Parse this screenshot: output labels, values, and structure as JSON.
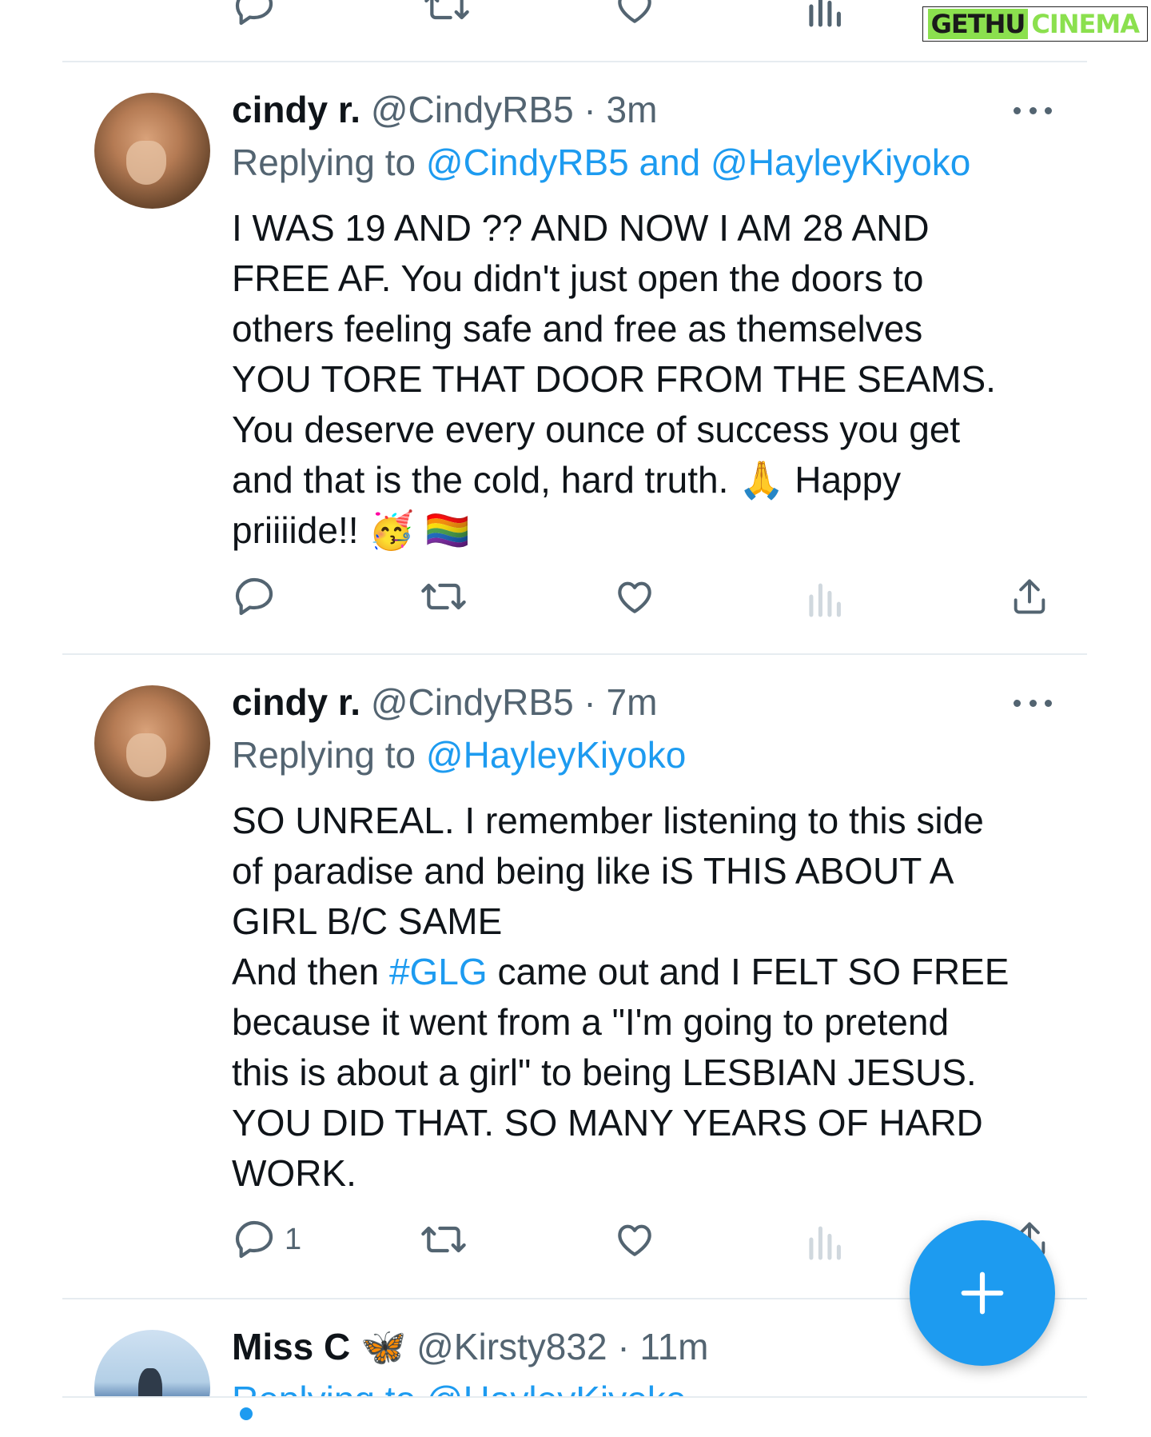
{
  "watermark": {
    "part1": "GETHU",
    "part2": "CINEMA"
  },
  "tweets": [
    {
      "name": "cindy r.",
      "handle_time": "@CindyRB5 · 3m",
      "replying_prefix": "Replying to ",
      "replying_to": "@CindyRB5 and @HayleyKiyoko",
      "lines": [
        "I WAS 19 AND ?? AND NOW I AM 28 AND",
        "FREE AF. You didn't just open the doors to",
        "others feeling safe and free as themselves",
        "YOU TORE THAT DOOR FROM THE SEAMS.",
        "You deserve every ounce of success you get",
        "and that is the cold, hard truth. 🙏 Happy",
        "priiiide!! 🥳 🏳️‍🌈"
      ],
      "reply_count": ""
    },
    {
      "name": "cindy r.",
      "handle_time": "@CindyRB5 · 7m",
      "replying_prefix": "Replying to ",
      "replying_to": "@HayleyKiyoko",
      "lines": [
        "SO UNREAL. I remember listening to this side",
        "of paradise and being like iS THIS ABOUT A",
        "GIRL B/C SAME"
      ],
      "line4_before": "And then ",
      "line4_hashtag": "#GLG",
      "line4_after": " came out and I FELT SO FREE",
      "lines_rest": [
        "because it went from a \"I'm going to pretend",
        "this is about a girl\" to being LESBIAN JESUS.",
        "YOU DID THAT. SO MANY YEARS OF HARD",
        "WORK."
      ],
      "reply_count": "1"
    },
    {
      "name": "Miss C",
      "name_emoji": "🦋",
      "handle_time": "@Kirsty832 · 11m",
      "replying_partial": "Replying to @HayleyKiyoko"
    }
  ],
  "icons": {
    "reply": "reply-icon",
    "retweet": "retweet-icon",
    "like": "heart-icon",
    "views": "views-icon",
    "share": "share-icon",
    "more": "more-icon",
    "compose": "compose-plus-icon"
  },
  "colors": {
    "accent": "#1d9bf0",
    "text": "#0f1419",
    "muted": "#536471",
    "divider": "#e6ecf0"
  }
}
